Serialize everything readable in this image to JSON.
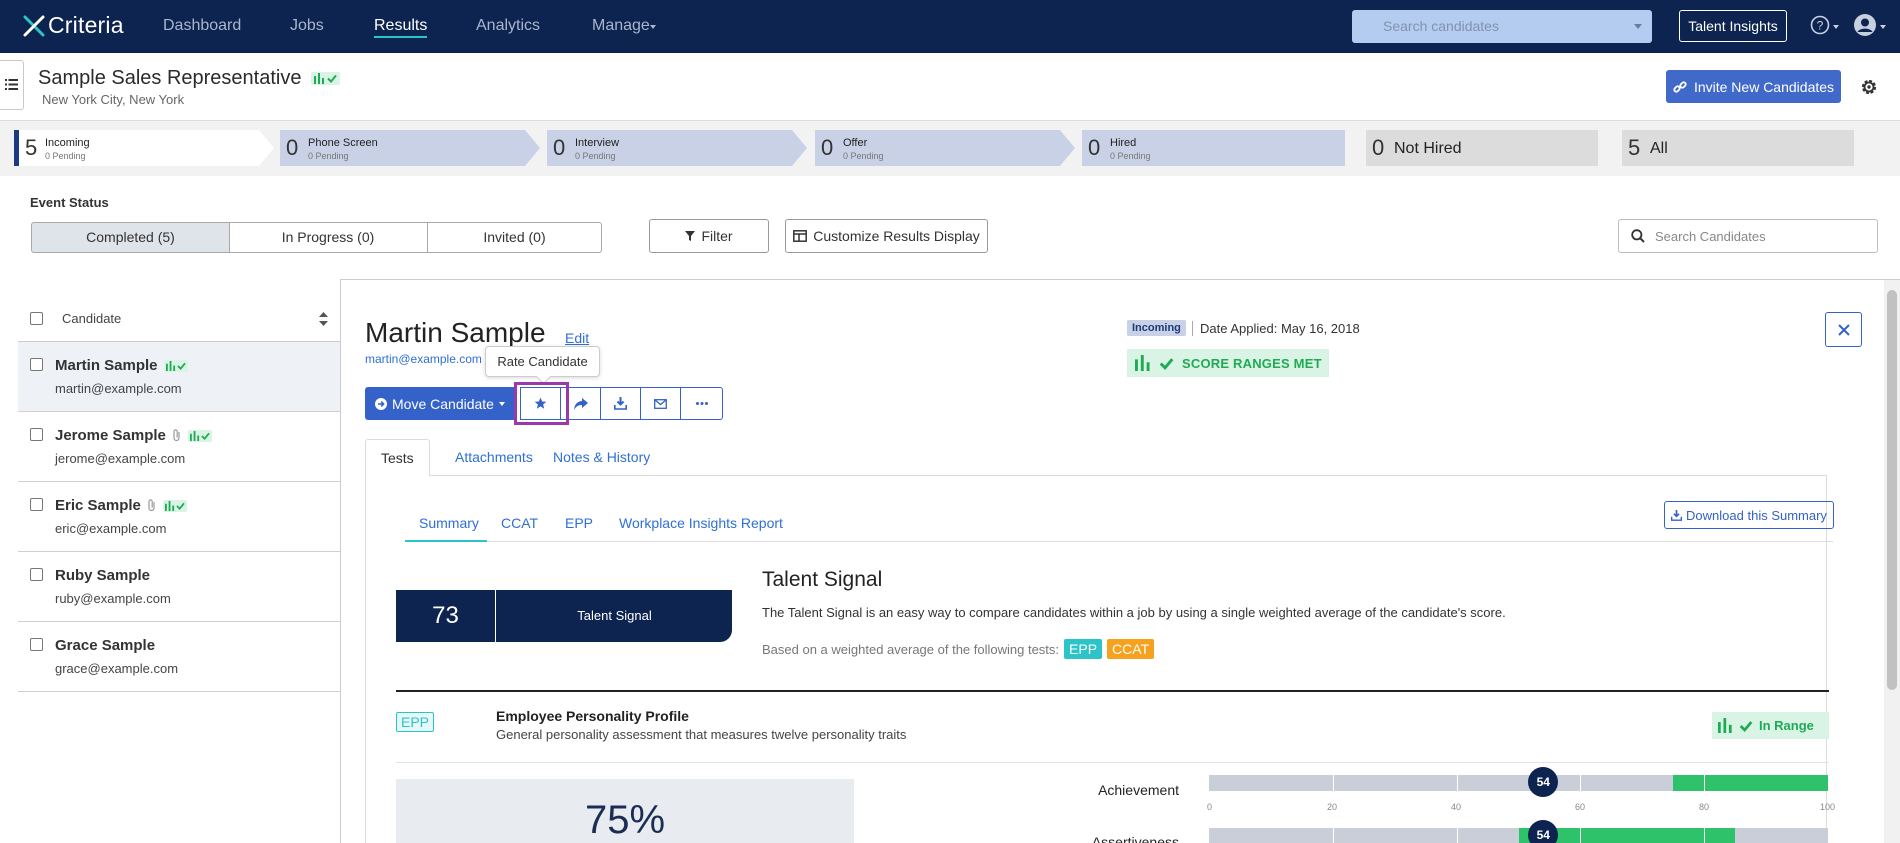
{
  "nav": {
    "brand": "Criteria",
    "links": [
      "Dashboard",
      "Jobs",
      "Results",
      "Analytics",
      "Manage"
    ],
    "search_placeholder": "Search candidates",
    "insights_label": "Talent Insights"
  },
  "job": {
    "title": "Sample Sales Representative",
    "location": "New York City, New York",
    "invite_label": "Invite New Candidates"
  },
  "pipeline": [
    {
      "count": "5",
      "name": "Incoming",
      "pending": "0 Pending"
    },
    {
      "count": "0",
      "name": "Phone Screen",
      "pending": "0 Pending"
    },
    {
      "count": "0",
      "name": "Interview",
      "pending": "0 Pending"
    },
    {
      "count": "0",
      "name": "Offer",
      "pending": "0 Pending"
    },
    {
      "count": "0",
      "name": "Hired",
      "pending": "0 Pending"
    },
    {
      "count": "0",
      "name": "Not Hired"
    },
    {
      "count": "5",
      "name": "All"
    }
  ],
  "event_status": {
    "title": "Event Status",
    "segments": [
      "Completed (5)",
      "In Progress (0)",
      "Invited (0)"
    ],
    "filter_label": "Filter",
    "customize_label": "Customize Results Display",
    "search_placeholder": "Search Candidates"
  },
  "list": {
    "header": "Candidate",
    "candidates": [
      {
        "name": "Martin Sample",
        "email": "martin@example.com"
      },
      {
        "name": "Jerome Sample",
        "email": "jerome@example.com"
      },
      {
        "name": "Eric Sample",
        "email": "eric@example.com"
      },
      {
        "name": "Ruby Sample",
        "email": "ruby@example.com"
      },
      {
        "name": "Grace Sample",
        "email": "grace@example.com"
      }
    ]
  },
  "detail": {
    "name": "Martin Sample",
    "edit_label": "Edit",
    "email": "martin@example.com",
    "tooltip": "Rate Candidate",
    "move_label": "Move Candidate",
    "status_chip": "Incoming",
    "date_applied": "Date Applied: May 16, 2018",
    "score_ranges": "SCORE RANGES MET",
    "tabs": [
      "Tests",
      "Attachments",
      "Notes & History"
    ],
    "subtabs": [
      "Summary",
      "CCAT",
      "EPP",
      "Workplace Insights Report"
    ],
    "download_label": "Download this Summary",
    "talent_signal": {
      "score": "73",
      "label": "Talent Signal",
      "title": "Talent Signal",
      "description": "The Talent Signal is an easy way to compare candidates within a job by using a single weighted average of the candidate's score.",
      "based_on": "Based on a weighted average of the following tests:",
      "tags": [
        "EPP",
        "CCAT"
      ]
    },
    "epp": {
      "tag": "EPP",
      "title": "Employee Personality Profile",
      "description": "General personality assessment that measures twelve personality traits",
      "in_range": "In Range",
      "percent": "75%",
      "ticks": [
        "0",
        "20",
        "40",
        "60",
        "80",
        "100"
      ],
      "traits": [
        {
          "label": "Achievement",
          "score": 54,
          "range": [
            75,
            100
          ]
        },
        {
          "label": "Assertiveness",
          "score": 54,
          "range": [
            50,
            85
          ]
        }
      ]
    }
  },
  "colors": {
    "navy": "#0d2350",
    "accent_blue": "#3462c9",
    "teal": "#2cc4c9",
    "green": "#2ec26a",
    "orange": "#f7a21e",
    "highlight": "#9a3aa8"
  }
}
